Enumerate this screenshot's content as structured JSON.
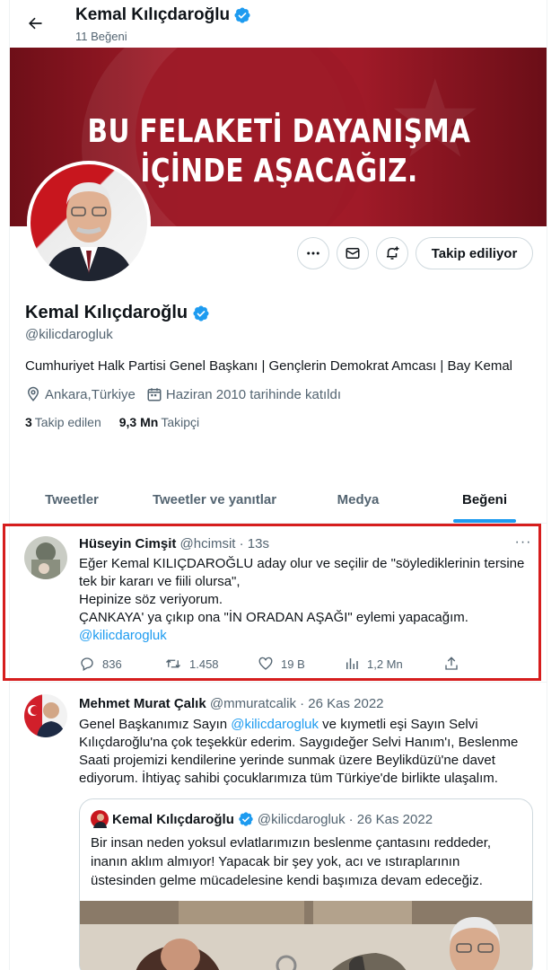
{
  "header": {
    "title": "Kemal Kılıçdaroğlu",
    "subtitle": "11 Beğeni"
  },
  "banner": {
    "line1": "BU FELAKETİ DAYANIŞMA",
    "line2": "İÇİNDE AŞACAĞIZ."
  },
  "profile": {
    "name": "Kemal Kılıçdaroğlu",
    "handle": "@kilicdarogluk",
    "bio": "Cumhuriyet Halk Partisi Genel Başkanı | Gençlerin Demokrat Amcası | Bay Kemal",
    "location": "Ankara,Türkiye",
    "joined": "Haziran 2010 tarihinde katıldı",
    "following_count": "3",
    "following_label": "Takip edilen",
    "followers_count": "9,3 Mn",
    "followers_label": "Takipçi",
    "follow_button": "Takip ediliyor"
  },
  "tabs": [
    {
      "label": "Tweetler"
    },
    {
      "label": "Tweetler ve yanıtlar"
    },
    {
      "label": "Medya"
    },
    {
      "label": "Beğeni",
      "active": true
    }
  ],
  "tweets": [
    {
      "name": "Hüseyin Cimşit",
      "handle": "@hcimsit",
      "time": "· 13s",
      "lines": [
        "Eğer Kemal KILIÇDAROĞLU aday olur ve seçilir de \"söylediklerinin tersine",
        "tek bir kararı ve fiili olursa\",",
        "Hepinize söz veriyorum.",
        "ÇANKAYA' ya çıkıp ona \"İN ORADAN AŞAĞI\" eylemi yapacağım."
      ],
      "mention": "@kilicdarogluk",
      "replies": "836",
      "retweets": "1.458",
      "likes": "19 B",
      "views": "1,2 Mn"
    },
    {
      "name": "Mehmet Murat Çalık",
      "handle": "@mmuratcalik",
      "time": "· 26 Kas 2022",
      "line1_pre": "Genel Başkanımız Sayın ",
      "line1_mention": "@kilicdarogluk",
      "line1_post": " ve kıymetli eşi Sayın Selvi",
      "lines": [
        "Kılıçdaroğlu'na çok teşekkür ederim. Saygıdeğer Selvi Hanım'ı, Beslenme",
        "Saati projemizi kendilerine yerinde sunmak üzere Beylikdüzü'ne davet",
        "ediyorum. İhtiyaç sahibi çocuklarımıza tüm Türkiye'de birlikte ulaşalım."
      ],
      "quote": {
        "name": "Kemal Kılıçdaroğlu",
        "handle": "@kilicdarogluk",
        "time": "· 26 Kas 2022",
        "lines": [
          "Bir insan neden yoksul evlatlarımızın beslenme çantasını reddeder,",
          "inanın aklım almıyor! Yapacak bir şey yok, acı ve ıstıraplarının",
          "üstesinden gelme mücadelesine kendi başımıza devam edeceğiz."
        ]
      }
    }
  ],
  "colors": {
    "accent": "#1d9bf0",
    "highlight_box": "#d61d1d",
    "text_secondary": "#536471"
  }
}
